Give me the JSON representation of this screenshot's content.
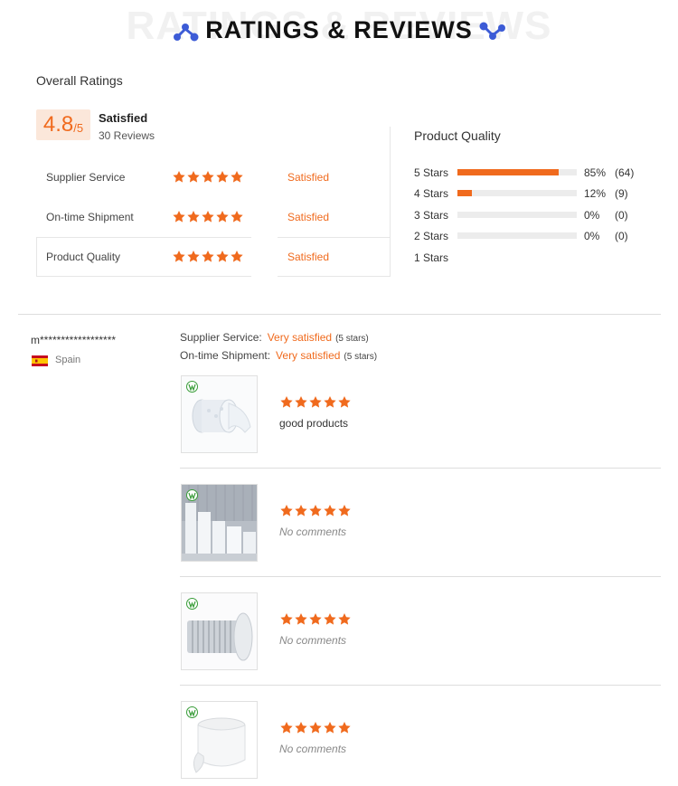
{
  "header": {
    "title": "RATINGS & REVIEWS",
    "watermark": "RATINGS & REVIEWS",
    "icon": "molecule-icon"
  },
  "overall": {
    "label": "Overall Ratings",
    "score": "4.8",
    "score_max": "/5",
    "status": "Satisfied",
    "reviews": "30 Reviews",
    "rows": [
      {
        "label": "Supplier Service",
        "stars": 5,
        "status": "Satisfied"
      },
      {
        "label": "On-time Shipment",
        "stars": 5,
        "status": "Satisfied"
      },
      {
        "label": "Product Quality",
        "stars": 5,
        "status": "Satisfied"
      }
    ]
  },
  "product_quality": {
    "title": "Product Quality",
    "distribution": [
      {
        "label": "5  Stars",
        "fraction": 0.85,
        "percent": "85%",
        "count": "(64)"
      },
      {
        "label": "4  Stars",
        "fraction": 0.12,
        "percent": "12%",
        "count": "(9)"
      },
      {
        "label": "3  Stars",
        "fraction": 0.0,
        "percent": "0%",
        "count": "(0)"
      },
      {
        "label": "2  Stars",
        "fraction": 0.0,
        "percent": "0%",
        "count": "(0)"
      },
      {
        "label": "1  Stars"
      }
    ]
  },
  "review": {
    "user": "m******************",
    "country": "Spain",
    "lines": [
      {
        "label": "Supplier Service:",
        "value": "Very satisfied",
        "stars": "(5 stars)"
      },
      {
        "label": "On-time Shipment:",
        "value": "Very satisfied",
        "stars": "(5 stars)"
      }
    ],
    "items": [
      {
        "stars": 5,
        "comment": "good products",
        "image": "bubble-wrap-roll"
      },
      {
        "stars": 5,
        "comment": "No comments",
        "image": "warehouse-rolls"
      },
      {
        "stars": 5,
        "comment": "No comments",
        "image": "air-column-roll"
      },
      {
        "stars": 5,
        "comment": "No comments",
        "image": "film-roll"
      }
    ]
  },
  "colors": {
    "accent": "#f06a1d",
    "score_bg": "#fbe7da",
    "bar_bg": "#ececec",
    "header_icon": "#3c5bd6"
  }
}
